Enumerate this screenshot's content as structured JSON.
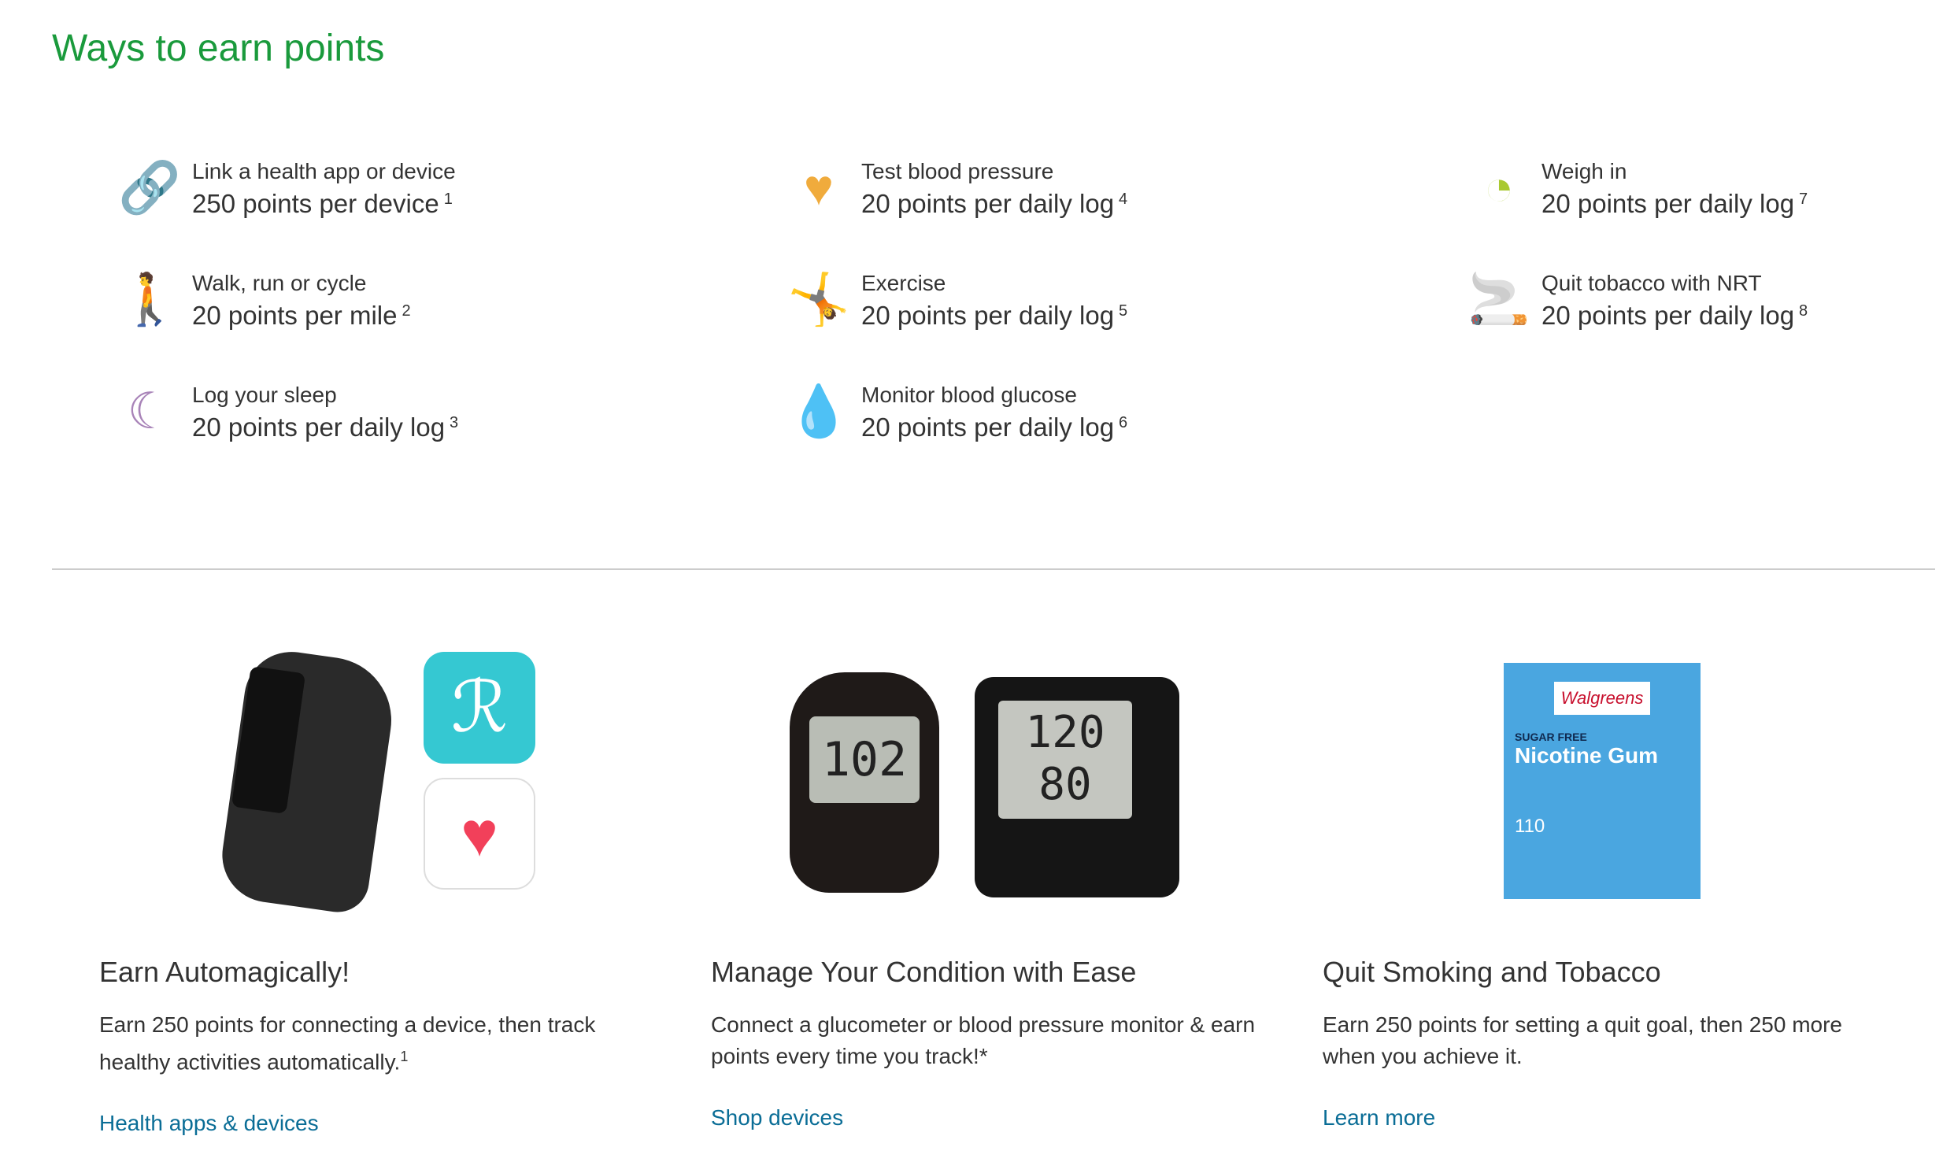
{
  "title": "Ways to earn points",
  "items": [
    {
      "icon": "link-icon",
      "color": "#e8559b",
      "label": "Link a health app or device",
      "value": "250 points per device",
      "note": "1"
    },
    {
      "icon": "heart-pulse-icon",
      "color": "#f0ab3c",
      "label": "Test blood pressure",
      "value": "20 points per daily log",
      "note": "4"
    },
    {
      "icon": "scale-icon",
      "color": "#a9c930",
      "label": "Weigh in",
      "value": "20 points per daily log",
      "note": "7"
    },
    {
      "icon": "walking-icon",
      "color": "#1fa3c5",
      "label": "Walk, run or cycle",
      "value": "20 points per mile",
      "note": "2"
    },
    {
      "icon": "exercise-icon",
      "color": "#e27623",
      "label": "Exercise",
      "value": "20 points per daily log",
      "note": "5"
    },
    {
      "icon": "no-smoking-icon",
      "color": "#a883b8",
      "label": "Quit tobacco with NRT",
      "value": "20 points per daily log",
      "note": "8"
    },
    {
      "icon": "moon-stars-icon",
      "color": "#a883b8",
      "label": "Log your sleep",
      "value": "20 points per daily log",
      "note": "3"
    },
    {
      "icon": "glucose-meter-icon",
      "color": "#7cc142",
      "label": "Monitor blood glucose",
      "value": "20 points per daily log",
      "note": "6"
    }
  ],
  "cards": [
    {
      "heading": "Earn Automagically!",
      "body": "Earn 250 points for connecting a device, then track healthy activities automatically.",
      "note": "1",
      "link": "Health apps & devices"
    },
    {
      "heading": "Manage Your Condition with Ease",
      "body": "Connect a glucometer or blood pressure monitor & earn points every time you track!*",
      "link": "Shop devices"
    },
    {
      "heading": "Quit Smoking and Tobacco",
      "body": "Earn 250 points for setting a quit goal, then 250 more when you achieve it.",
      "link": "Learn more"
    }
  ],
  "images": {
    "glucometer_reading": "102",
    "bp_sys": "120",
    "bp_dia": "80",
    "gum_brand": "Walgreens",
    "gum_label": "SUGAR FREE",
    "gum_name": "Nicotine Gum",
    "gum_count": "110"
  }
}
